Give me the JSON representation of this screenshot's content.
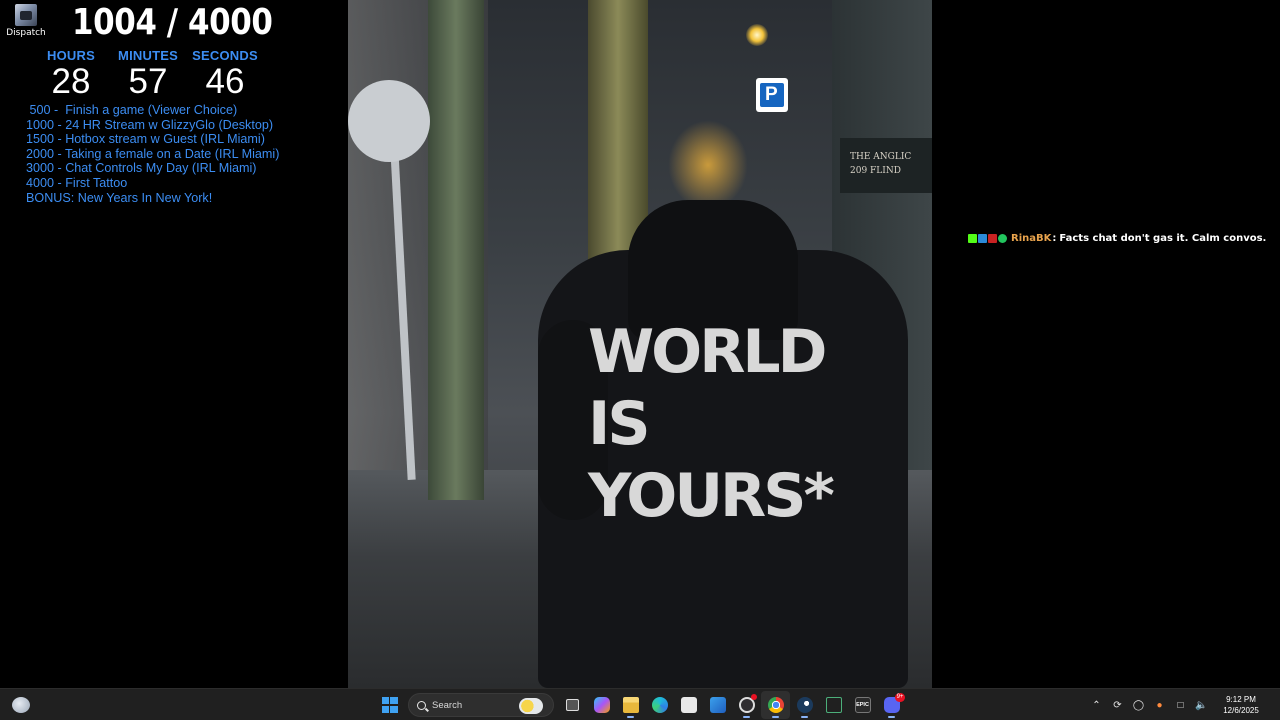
{
  "desktop": {
    "icon_label": "Dispatch"
  },
  "overlay": {
    "counter": "1004 / 4000",
    "timer": {
      "hours_label": "HOURS",
      "hours_value": "28",
      "minutes_label": "MINUTES",
      "minutes_value": "57",
      "seconds_label": "SECONDS",
      "seconds_value": "46"
    },
    "goals": [
      " 500 -  Finish a game (Viewer Choice)",
      "1000 - 24 HR Stream w GlizzyGlo (Desktop)",
      "1500 - Hotbox stream w Guest (IRL Miami)",
      "2000 - Taking a female on a Date (IRL Miami)",
      "3000 - Chat Controls My Day (IRL Miami)",
      "4000 - First Tattoo",
      "BONUS: New Years In New York!"
    ],
    "accent_color": "#3c8df2"
  },
  "photo": {
    "hoodie_print": [
      "WORLD",
      "IS",
      "YOURS*"
    ],
    "building_plaque": [
      "THE ANGLIC",
      "209 FLIND"
    ],
    "parking_sign": "P"
  },
  "chat": {
    "user": "RinaBK",
    "separator": ":",
    "message": "Facts chat don't gas it. Calm convos.",
    "user_color": "#e8a34d"
  },
  "taskbar": {
    "search_placeholder": "Search",
    "epic_label": "EPIC",
    "discord_badge": "9+",
    "time": "9:12 PM",
    "date": "12/6/2025"
  }
}
